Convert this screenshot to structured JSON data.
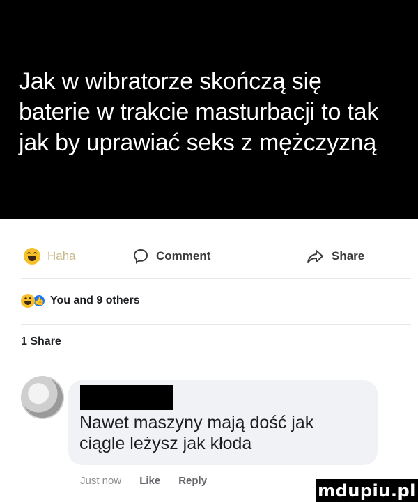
{
  "post": {
    "text_line1": "Jak w wibratorze skończą się",
    "text_line2": "baterie w trakcie masturbacji to tak",
    "text_line3": "jak by uprawiać seks z mężczyzną"
  },
  "actions": {
    "haha_label": "Haha",
    "comment_label": "Comment",
    "share_label": "Share"
  },
  "reactions": {
    "summary": "You and 9 others"
  },
  "shares": {
    "count_label": "1 Share"
  },
  "comment": {
    "line1": "Nawet maszyny mają dość jak",
    "line2": "ciągle leżysz jak kłoda",
    "time": "Just now",
    "like_label": "Like",
    "reply_label": "Reply"
  },
  "watermark": {
    "text": "mdupiu.pl"
  },
  "colors": {
    "like_blue": "#1877f2",
    "haha_yellow": "#f7c02a",
    "bubble_bg": "#f0f2f5"
  }
}
